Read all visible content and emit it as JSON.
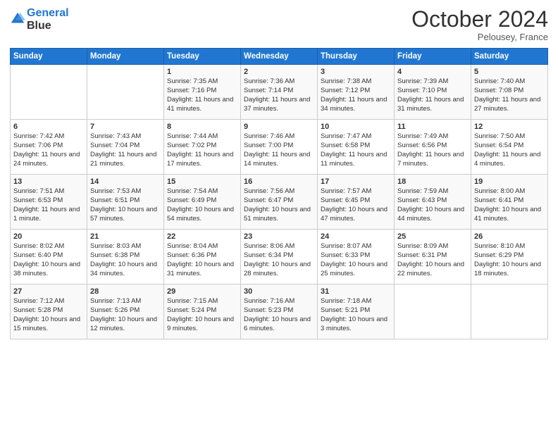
{
  "header": {
    "logo_line1": "General",
    "logo_line2": "Blue",
    "month_title": "October 2024",
    "location": "Pelousey, France"
  },
  "days_of_week": [
    "Sunday",
    "Monday",
    "Tuesday",
    "Wednesday",
    "Thursday",
    "Friday",
    "Saturday"
  ],
  "weeks": [
    [
      {
        "day": "",
        "info": ""
      },
      {
        "day": "",
        "info": ""
      },
      {
        "day": "1",
        "info": "Sunrise: 7:35 AM\nSunset: 7:16 PM\nDaylight: 11 hours and 41 minutes."
      },
      {
        "day": "2",
        "info": "Sunrise: 7:36 AM\nSunset: 7:14 PM\nDaylight: 11 hours and 37 minutes."
      },
      {
        "day": "3",
        "info": "Sunrise: 7:38 AM\nSunset: 7:12 PM\nDaylight: 11 hours and 34 minutes."
      },
      {
        "day": "4",
        "info": "Sunrise: 7:39 AM\nSunset: 7:10 PM\nDaylight: 11 hours and 31 minutes."
      },
      {
        "day": "5",
        "info": "Sunrise: 7:40 AM\nSunset: 7:08 PM\nDaylight: 11 hours and 27 minutes."
      }
    ],
    [
      {
        "day": "6",
        "info": "Sunrise: 7:42 AM\nSunset: 7:06 PM\nDaylight: 11 hours and 24 minutes."
      },
      {
        "day": "7",
        "info": "Sunrise: 7:43 AM\nSunset: 7:04 PM\nDaylight: 11 hours and 21 minutes."
      },
      {
        "day": "8",
        "info": "Sunrise: 7:44 AM\nSunset: 7:02 PM\nDaylight: 11 hours and 17 minutes."
      },
      {
        "day": "9",
        "info": "Sunrise: 7:46 AM\nSunset: 7:00 PM\nDaylight: 11 hours and 14 minutes."
      },
      {
        "day": "10",
        "info": "Sunrise: 7:47 AM\nSunset: 6:58 PM\nDaylight: 11 hours and 11 minutes."
      },
      {
        "day": "11",
        "info": "Sunrise: 7:49 AM\nSunset: 6:56 PM\nDaylight: 11 hours and 7 minutes."
      },
      {
        "day": "12",
        "info": "Sunrise: 7:50 AM\nSunset: 6:54 PM\nDaylight: 11 hours and 4 minutes."
      }
    ],
    [
      {
        "day": "13",
        "info": "Sunrise: 7:51 AM\nSunset: 6:53 PM\nDaylight: 11 hours and 1 minute."
      },
      {
        "day": "14",
        "info": "Sunrise: 7:53 AM\nSunset: 6:51 PM\nDaylight: 10 hours and 57 minutes."
      },
      {
        "day": "15",
        "info": "Sunrise: 7:54 AM\nSunset: 6:49 PM\nDaylight: 10 hours and 54 minutes."
      },
      {
        "day": "16",
        "info": "Sunrise: 7:56 AM\nSunset: 6:47 PM\nDaylight: 10 hours and 51 minutes."
      },
      {
        "day": "17",
        "info": "Sunrise: 7:57 AM\nSunset: 6:45 PM\nDaylight: 10 hours and 47 minutes."
      },
      {
        "day": "18",
        "info": "Sunrise: 7:59 AM\nSunset: 6:43 PM\nDaylight: 10 hours and 44 minutes."
      },
      {
        "day": "19",
        "info": "Sunrise: 8:00 AM\nSunset: 6:41 PM\nDaylight: 10 hours and 41 minutes."
      }
    ],
    [
      {
        "day": "20",
        "info": "Sunrise: 8:02 AM\nSunset: 6:40 PM\nDaylight: 10 hours and 38 minutes."
      },
      {
        "day": "21",
        "info": "Sunrise: 8:03 AM\nSunset: 6:38 PM\nDaylight: 10 hours and 34 minutes."
      },
      {
        "day": "22",
        "info": "Sunrise: 8:04 AM\nSunset: 6:36 PM\nDaylight: 10 hours and 31 minutes."
      },
      {
        "day": "23",
        "info": "Sunrise: 8:06 AM\nSunset: 6:34 PM\nDaylight: 10 hours and 28 minutes."
      },
      {
        "day": "24",
        "info": "Sunrise: 8:07 AM\nSunset: 6:33 PM\nDaylight: 10 hours and 25 minutes."
      },
      {
        "day": "25",
        "info": "Sunrise: 8:09 AM\nSunset: 6:31 PM\nDaylight: 10 hours and 22 minutes."
      },
      {
        "day": "26",
        "info": "Sunrise: 8:10 AM\nSunset: 6:29 PM\nDaylight: 10 hours and 18 minutes."
      }
    ],
    [
      {
        "day": "27",
        "info": "Sunrise: 7:12 AM\nSunset: 5:28 PM\nDaylight: 10 hours and 15 minutes."
      },
      {
        "day": "28",
        "info": "Sunrise: 7:13 AM\nSunset: 5:26 PM\nDaylight: 10 hours and 12 minutes."
      },
      {
        "day": "29",
        "info": "Sunrise: 7:15 AM\nSunset: 5:24 PM\nDaylight: 10 hours and 9 minutes."
      },
      {
        "day": "30",
        "info": "Sunrise: 7:16 AM\nSunset: 5:23 PM\nDaylight: 10 hours and 6 minutes."
      },
      {
        "day": "31",
        "info": "Sunrise: 7:18 AM\nSunset: 5:21 PM\nDaylight: 10 hours and 3 minutes."
      },
      {
        "day": "",
        "info": ""
      },
      {
        "day": "",
        "info": ""
      }
    ]
  ]
}
